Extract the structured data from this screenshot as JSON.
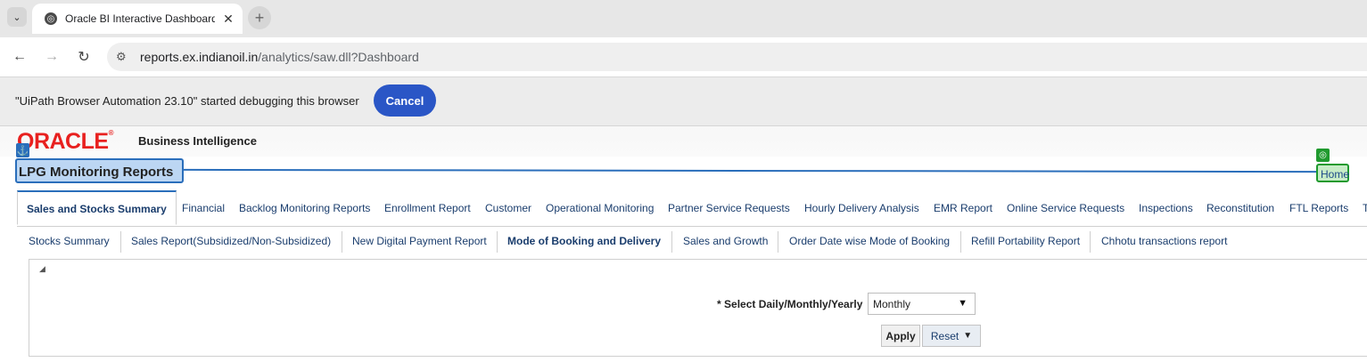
{
  "browser": {
    "tab_title": "Oracle BI Interactive Dashboards",
    "url_host": "reports.ex.indianoil.in",
    "url_path": "/analytics/saw.dll?Dashboard"
  },
  "infobar": {
    "message": "\"UiPath Browser Automation 23.10\" started debugging this browser",
    "cancel_label": "Cancel"
  },
  "obi": {
    "logo_text": "ORACLE",
    "product": "Business Intelligence",
    "page_title": "LPG Monitoring Reports",
    "home_label": "Home",
    "main_tabs": [
      "Sales and Stocks Summary",
      "Financial",
      "Backlog Monitoring Reports",
      "Enrollment Report",
      "Customer",
      "Operational Monitoring",
      "Partner Service Requests",
      "Hourly Delivery Analysis",
      "EMR Report",
      "Online Service Requests",
      "Inspections",
      "Reconstitution",
      "FTL Reports",
      "T"
    ],
    "sub_tabs": [
      "Stocks Summary",
      "Sales Report(Subsidized/Non-Subsidized)",
      "New Digital Payment Report",
      "Mode of Booking and Delivery",
      "Sales and Growth",
      "Order Date wise Mode of Booking",
      "Refill Portability Report",
      "Chhotu transactions report"
    ],
    "prompt": {
      "required_marker": "*",
      "label": "Select Daily/Monthly/Yearly",
      "selected": "Monthly",
      "apply_label": "Apply",
      "reset_label": "Reset"
    }
  },
  "colors": {
    "oracle_red": "#e8201f",
    "link_blue": "#1a3d6d",
    "automation_blue": "#2a6ebb",
    "automation_green": "#1f9a2e",
    "cancel_button": "#2a56c6"
  }
}
